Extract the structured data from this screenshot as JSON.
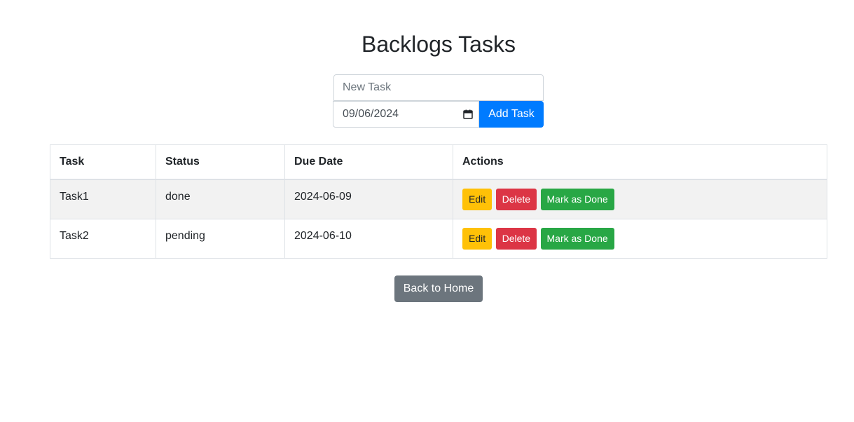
{
  "page": {
    "title": "Backlogs Tasks"
  },
  "form": {
    "task_placeholder": "New Task",
    "task_value": "",
    "date_value": "09/06/2024",
    "date_icon": "calendar-icon",
    "add_label": "Add Task"
  },
  "table": {
    "headers": [
      "Task",
      "Status",
      "Due Date",
      "Actions"
    ],
    "rows": [
      {
        "task": "Task1",
        "status": "done",
        "due": "2024-06-09",
        "actions": {
          "edit": "Edit",
          "delete": "Delete",
          "done": "Mark as Done"
        }
      },
      {
        "task": "Task2",
        "status": "pending",
        "due": "2024-06-10",
        "actions": {
          "edit": "Edit",
          "delete": "Delete",
          "done": "Mark as Done"
        }
      }
    ]
  },
  "footer": {
    "home_label": "Back to Home"
  },
  "colors": {
    "primary": "#007bff",
    "warning": "#ffc107",
    "danger": "#dc3545",
    "success": "#28a745",
    "secondary": "#6c757d",
    "stripe": "#f2f2f2"
  }
}
